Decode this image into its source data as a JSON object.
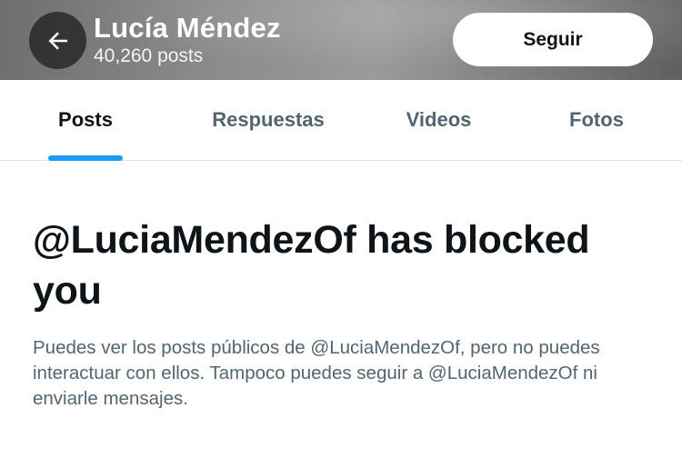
{
  "header": {
    "name": "Lucía Méndez",
    "post_count": "40,260 posts",
    "follow_label": "Seguir",
    "back_icon": "arrow-left-icon"
  },
  "tabs": [
    {
      "label": "Posts",
      "active": true
    },
    {
      "label": "Respuestas",
      "active": false
    },
    {
      "label": "Videos",
      "active": false
    },
    {
      "label": "Fotos",
      "active": false
    }
  ],
  "blocked": {
    "title": "@LuciaMendezOf has blocked you",
    "description": "Puedes ver los posts públicos de @LuciaMendezOf, pero no puedes interactuar con ellos. Tampoco puedes seguir a @LuciaMendezOf ni enviarle mensajes."
  },
  "colors": {
    "accent": "#1d9bf0",
    "text_primary": "#0f1419",
    "text_secondary": "#536471"
  }
}
